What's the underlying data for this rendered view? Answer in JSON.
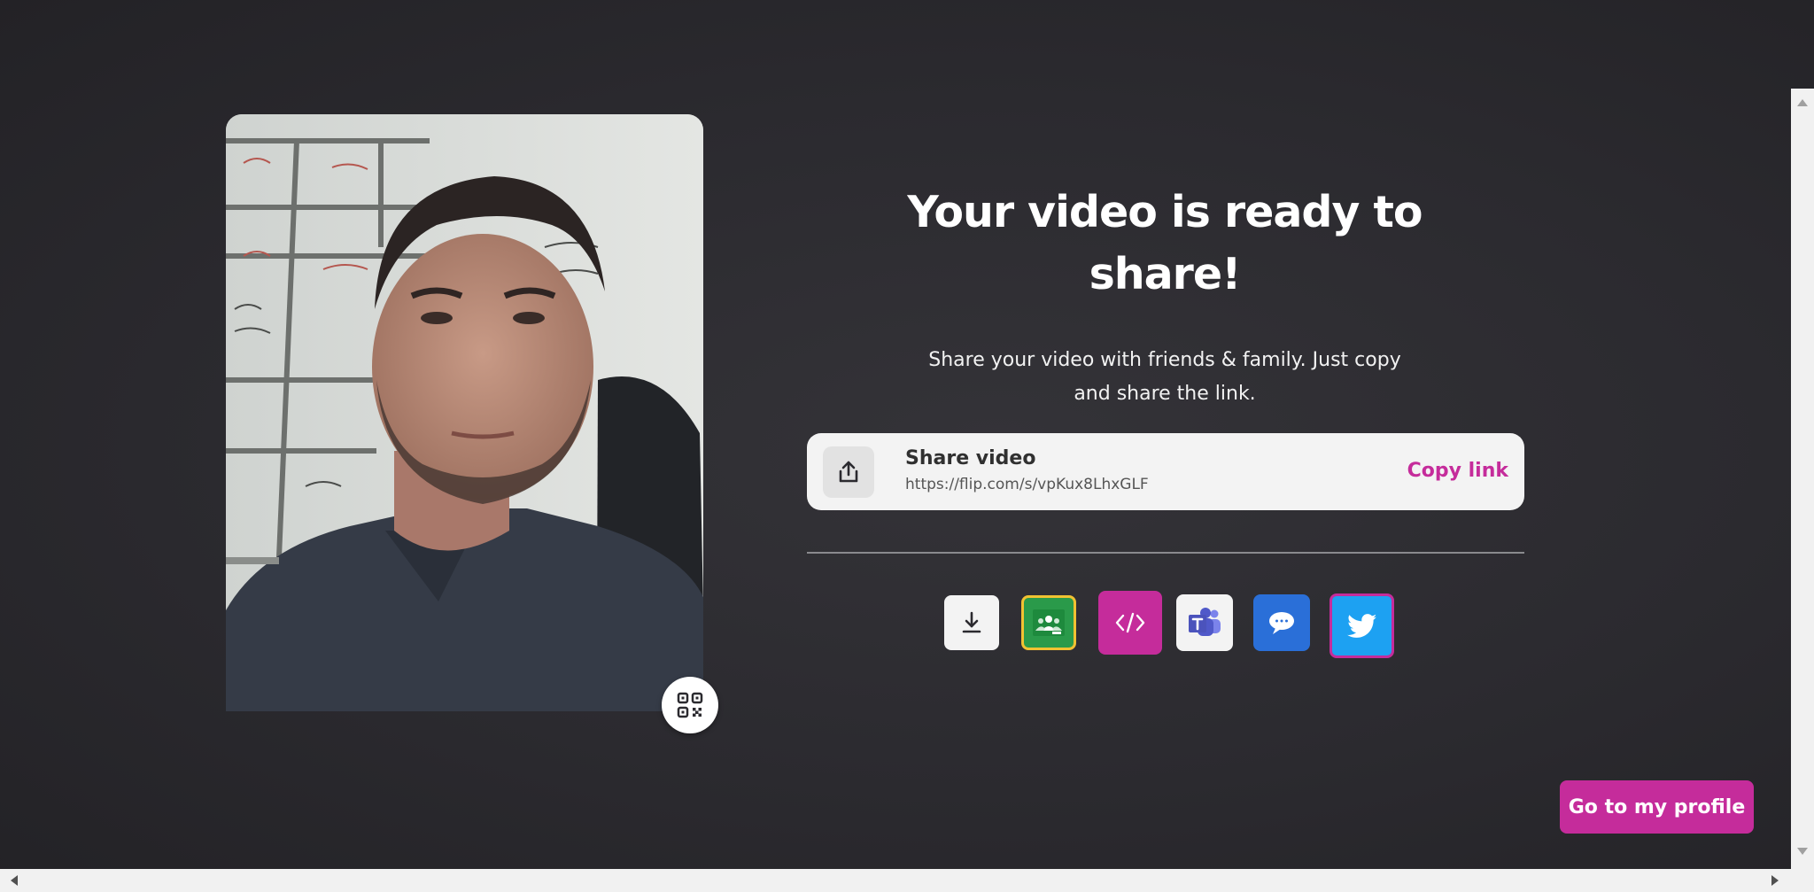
{
  "headline": "Your video is ready to share!",
  "subtext": "Share your video with friends & family. Just copy and share the link.",
  "share_card": {
    "title": "Share video",
    "url": "https://flip.com/s/vpKux8LhxGLF",
    "copy_label": "Copy link",
    "icon": "share-upload-icon"
  },
  "share_buttons": [
    {
      "name": "download",
      "icon": "download-icon",
      "bg": "#f3f3f3"
    },
    {
      "name": "google-classroom",
      "icon": "google-classroom-icon",
      "bg": "#2a9a4a"
    },
    {
      "name": "embed",
      "icon": "embed-code-icon",
      "bg": "#c52c9b"
    },
    {
      "name": "microsoft-teams",
      "icon": "microsoft-teams-icon",
      "bg": "#f3f3f3"
    },
    {
      "name": "remind",
      "icon": "remind-icon",
      "bg": "#2a6fd8"
    },
    {
      "name": "twitter",
      "icon": "twitter-icon",
      "bg": "#1da1f2"
    }
  ],
  "profile_button_label": "Go to my profile",
  "qr_icon": "qr-code-icon",
  "colors": {
    "accent": "#c52c9b",
    "background": "#2b2a2f"
  }
}
